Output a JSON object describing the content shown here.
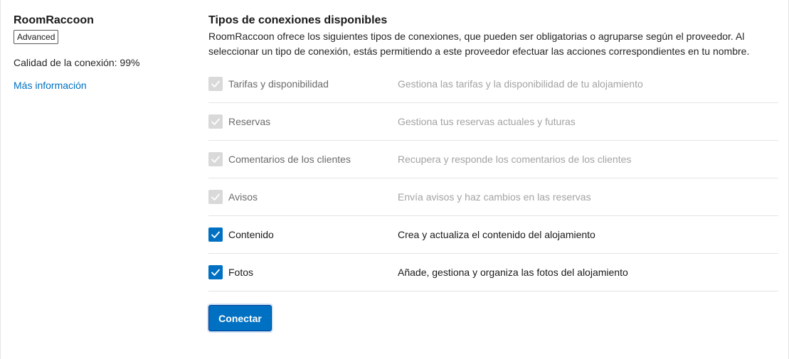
{
  "provider": {
    "name": "RoomRaccoon",
    "badge": "Advanced",
    "quality": "Calidad de la conexión: 99%",
    "more_info": "Más información"
  },
  "connections": {
    "title": "Tipos de conexiones disponibles",
    "description": "RoomRaccoon ofrece los siguientes tipos de conexiones, que pueden ser obligatorias o agruparse según el proveedor. Al seleccionar un tipo de conexión, estás permitiendo a este proveedor efectuar las acciones correspondientes en tu nombre.",
    "items": [
      {
        "label": "Tarifas y disponibilidad",
        "desc": "Gestiona las tarifas y la disponibilidad de tu alojamiento",
        "checked": true,
        "disabled": true
      },
      {
        "label": "Reservas",
        "desc": "Gestiona tus reservas actuales y futuras",
        "checked": true,
        "disabled": true
      },
      {
        "label": "Comentarios de los clientes",
        "desc": "Recupera y responde los comentarios de los clientes",
        "checked": true,
        "disabled": true
      },
      {
        "label": "Avisos",
        "desc": "Envía avisos y haz cambios en las reservas",
        "checked": true,
        "disabled": true
      },
      {
        "label": "Contenido",
        "desc": "Crea y actualiza el contenido del alojamiento",
        "checked": true,
        "disabled": false
      },
      {
        "label": "Fotos",
        "desc": "Añade, gestiona y organiza las fotos del alojamiento",
        "checked": true,
        "disabled": false
      }
    ],
    "connect_button": "Conectar"
  },
  "colors": {
    "accent": "#0071c2",
    "checkbox_disabled": "#d9d9d9",
    "divider": "#e4e4e4"
  },
  "icons": {
    "checkbox_check": "checkmark-icon"
  }
}
